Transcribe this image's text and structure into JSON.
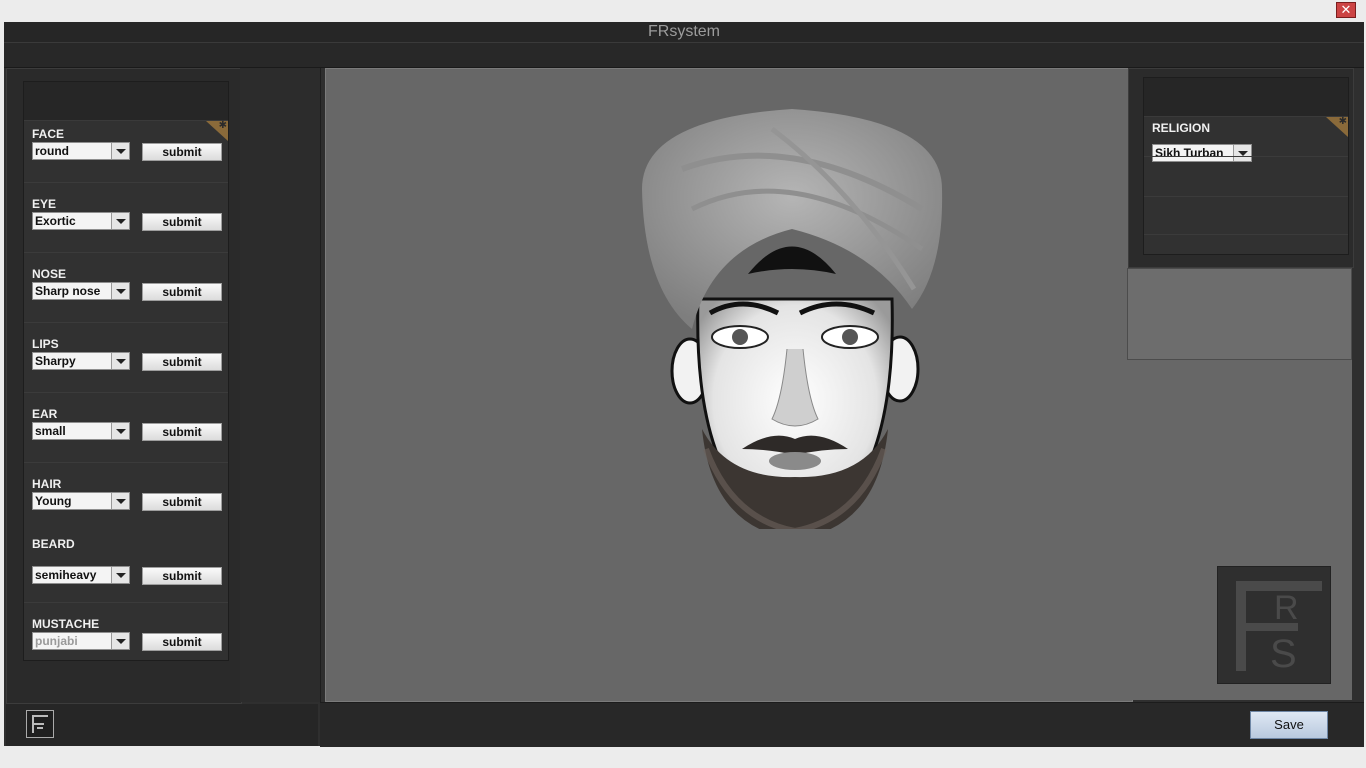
{
  "window": {
    "title": "FRsystem",
    "close_glyph": "✕"
  },
  "features": [
    {
      "label": "FACE",
      "value": "round",
      "button": "submit"
    },
    {
      "label": "EYE",
      "value": "Exortic",
      "button": "submit"
    },
    {
      "label": "NOSE",
      "value": "Sharp nose",
      "button": "submit"
    },
    {
      "label": "LIPS",
      "value": "Sharpy",
      "button": "submit"
    },
    {
      "label": "EAR",
      "value": "small",
      "button": "submit"
    },
    {
      "label": "HAIR",
      "value": "Young",
      "button": "submit"
    },
    {
      "label": "BEARD",
      "value": "semiheavy",
      "button": "submit"
    },
    {
      "label": "MUSTACHE",
      "value": "punjabi",
      "button": "submit"
    }
  ],
  "religion": {
    "label": "RELIGION",
    "value": "Sikh Turban"
  },
  "actions": {
    "save_label": "Save"
  },
  "logo": {
    "letters": [
      "F",
      "R",
      "S"
    ]
  },
  "colors": {
    "window_bg": "#2f2f2f",
    "canvas_bg": "#676767",
    "save_button": "#c8d6e8",
    "corner_flag": "#8a6a3a"
  },
  "icons": {
    "close": "close-icon",
    "dropdown": "chevron-down-icon",
    "logo": "frs-logo-icon"
  }
}
